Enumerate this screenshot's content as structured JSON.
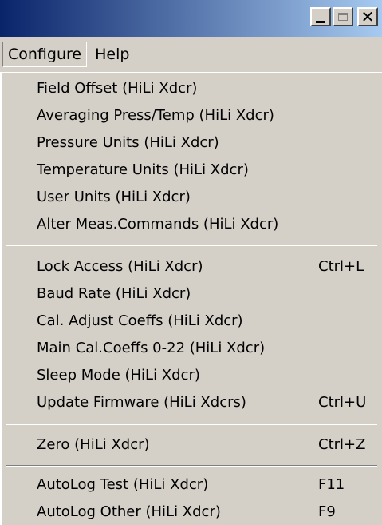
{
  "window": {
    "minimize_symbol": "_",
    "close_symbol": "✕"
  },
  "menubar": {
    "items": [
      {
        "label": "Configure"
      },
      {
        "label": "Help"
      }
    ]
  },
  "dropdown": {
    "group1": [
      {
        "label": "Field Offset (HiLi Xdcr)",
        "shortcut": ""
      },
      {
        "label": "Averaging Press/Temp (HiLi Xdcr)",
        "shortcut": ""
      },
      {
        "label": "Pressure Units (HiLi Xdcr)",
        "shortcut": ""
      },
      {
        "label": "Temperature Units (HiLi Xdcr)",
        "shortcut": ""
      },
      {
        "label": "User Units (HiLi Xdcr)",
        "shortcut": ""
      },
      {
        "label": "Alter Meas.Commands (HiLi Xdcr)",
        "shortcut": ""
      }
    ],
    "group2": [
      {
        "label": "Lock Access (HiLi Xdcr)",
        "shortcut": "Ctrl+L"
      },
      {
        "label": "Baud Rate (HiLi Xdcr)",
        "shortcut": ""
      },
      {
        "label": "Cal. Adjust Coeffs (HiLi Xdcr)",
        "shortcut": ""
      },
      {
        "label": "Main Cal.Coeffs 0-22 (HiLi Xdcr)",
        "shortcut": ""
      },
      {
        "label": "Sleep Mode (HiLi Xdcr)",
        "shortcut": ""
      },
      {
        "label": "Update Firmware (HiLi Xdcrs)",
        "shortcut": "Ctrl+U"
      }
    ],
    "group3": [
      {
        "label": "Zero (HiLi Xdcr)",
        "shortcut": "Ctrl+Z"
      }
    ],
    "group4": [
      {
        "label": "AutoLog Test (HiLi Xdcr)",
        "shortcut": "F11"
      },
      {
        "label": "AutoLog Other (HiLi Xdcr)",
        "shortcut": "F9"
      }
    ]
  }
}
